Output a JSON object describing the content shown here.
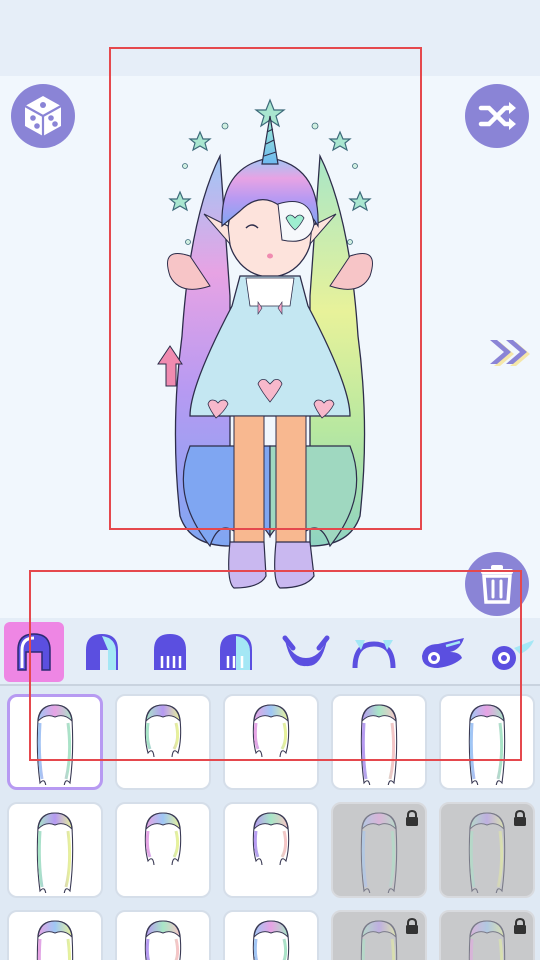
{
  "app": {
    "colors": {
      "accent": "#8a84d6",
      "active_tab": "#ee86e4",
      "selection": "#b79af2",
      "locked_item": "#c8c9cb",
      "highlight_box": "#e5484d"
    }
  },
  "controls": {
    "random_icon": "dice-icon",
    "shuffle_icon": "shuffle-icon",
    "next_icon": "double-chevron-right-icon",
    "delete_icon": "trash-icon"
  },
  "categories": [
    {
      "icon": "hair-front-icon",
      "active": true
    },
    {
      "icon": "hair-back-icon",
      "active": false
    },
    {
      "icon": "hair-bangs-icon",
      "active": false
    },
    {
      "icon": "hair-long-icon",
      "active": false
    },
    {
      "icon": "horns-icon",
      "active": false
    },
    {
      "icon": "headband-icon",
      "active": false
    },
    {
      "icon": "wings-icon",
      "active": false
    },
    {
      "icon": "tail-icon",
      "active": false
    }
  ],
  "items": [
    {
      "icon": "hairstyle-icon",
      "selected": true,
      "locked": false
    },
    {
      "icon": "hairstyle-icon",
      "selected": false,
      "locked": false
    },
    {
      "icon": "hairstyle-icon",
      "selected": false,
      "locked": false
    },
    {
      "icon": "hairstyle-icon",
      "selected": false,
      "locked": false
    },
    {
      "icon": "hairstyle-icon",
      "selected": false,
      "locked": false
    },
    {
      "icon": "hairstyle-icon",
      "selected": false,
      "locked": false
    },
    {
      "icon": "hairstyle-icon",
      "selected": false,
      "locked": false
    },
    {
      "icon": "hairstyle-icon",
      "selected": false,
      "locked": false
    },
    {
      "icon": "hairstyle-icon",
      "selected": false,
      "locked": true
    },
    {
      "icon": "hairstyle-icon",
      "selected": false,
      "locked": true
    },
    {
      "icon": "hairstyle-icon",
      "selected": false,
      "locked": false
    },
    {
      "icon": "hairstyle-icon",
      "selected": false,
      "locked": false
    },
    {
      "icon": "hairstyle-icon",
      "selected": false,
      "locked": false
    },
    {
      "icon": "hairstyle-icon",
      "selected": false,
      "locked": true
    },
    {
      "icon": "hairstyle-icon",
      "selected": false,
      "locked": true
    }
  ]
}
